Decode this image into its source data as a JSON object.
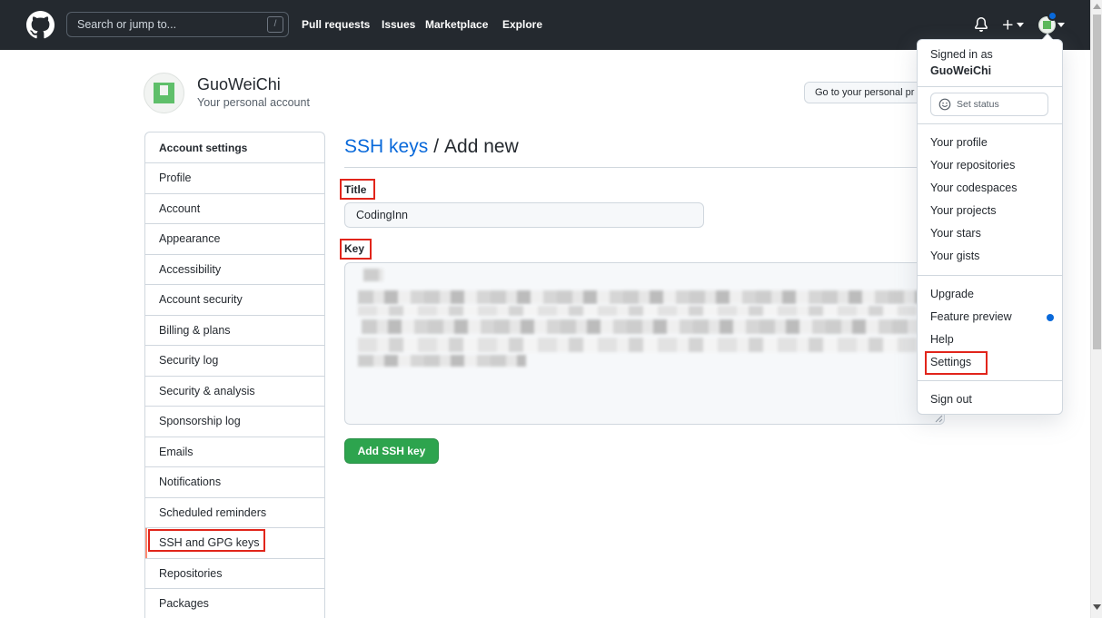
{
  "header": {
    "search_placeholder": "Search or jump to...",
    "search_shortcut": "/",
    "nav": [
      "Pull requests",
      "Issues",
      "Marketplace",
      "Explore"
    ]
  },
  "account": {
    "name": "GuoWeiChi",
    "subtitle": "Your personal account",
    "profile_button": "Go to your personal pr"
  },
  "sidebar": {
    "heading": "Account settings",
    "items": [
      "Profile",
      "Account",
      "Appearance",
      "Accessibility",
      "Account security",
      "Billing & plans",
      "Security log",
      "Security & analysis",
      "Sponsorship log",
      "Emails",
      "Notifications",
      "Scheduled reminders",
      "SSH and GPG keys",
      "Repositories",
      "Packages"
    ],
    "selected_index": 12
  },
  "main": {
    "breadcrumb_link": "SSH keys",
    "breadcrumb_separator": "/",
    "breadcrumb_current": "Add new",
    "form": {
      "title_label": "Title",
      "title_value": "CodingInn",
      "key_label": "Key",
      "submit_label": "Add SSH key"
    }
  },
  "user_menu": {
    "signed_in_label": "Signed in as",
    "username": "GuoWeiChi",
    "set_status_label": "Set status",
    "primary_items": [
      "Your profile",
      "Your repositories",
      "Your codespaces",
      "Your projects",
      "Your stars",
      "Your gists"
    ],
    "secondary_items": [
      "Upgrade",
      "Feature preview",
      "Help",
      "Settings"
    ],
    "sign_out_label": "Sign out"
  },
  "icons": {
    "logo": "github-logo-icon",
    "notifications": "bell-icon",
    "create": "plus-icon",
    "dropdown": "chevron-down-icon",
    "status": "smiley-icon",
    "textarea_resize": "resize-handle-icon"
  },
  "colors": {
    "header_bg": "#24292f",
    "link": "#0969da",
    "primary_button": "#2da44e",
    "selected_marker": "#fd8c73",
    "notification_dot": "#0969da",
    "annotation": "#e1251b"
  }
}
